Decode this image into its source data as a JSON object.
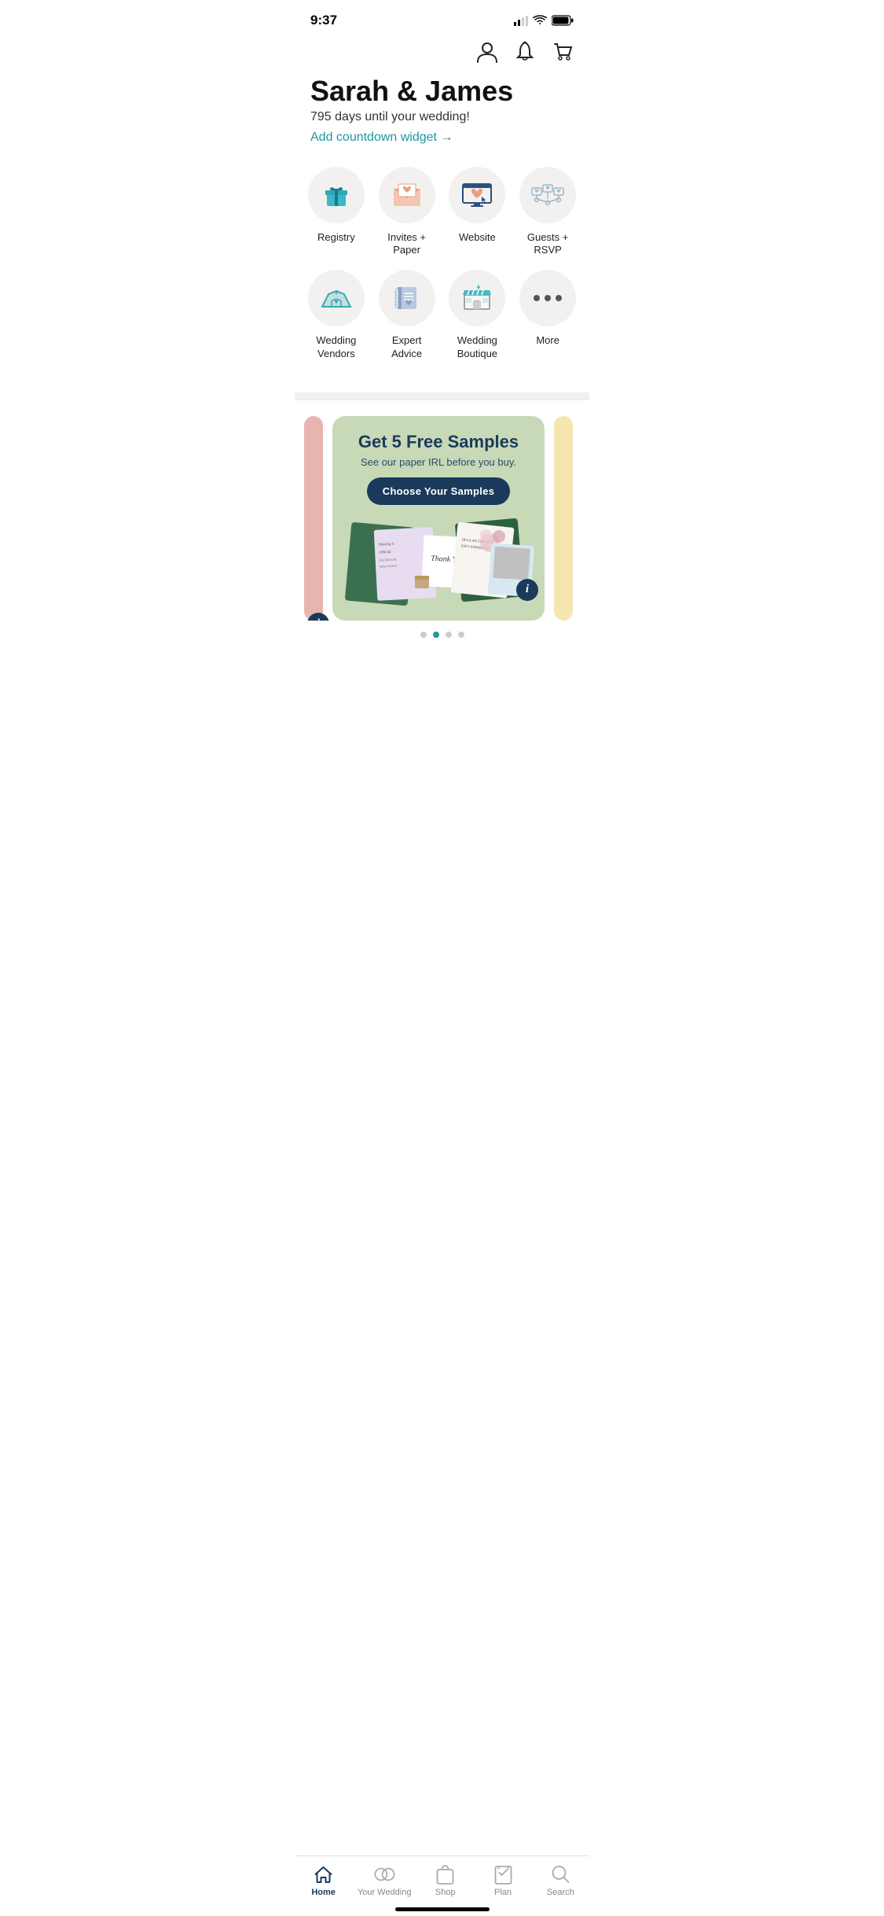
{
  "statusBar": {
    "time": "9:37"
  },
  "header": {
    "coupleName": "Sarah & James",
    "countdownText": "795 days until your wedding!",
    "countdownLink": "Add countdown widget →"
  },
  "navItems": [
    {
      "id": "registry",
      "label": "Registry",
      "icon": "gift"
    },
    {
      "id": "invites",
      "label": "Invites +\nPaper",
      "icon": "envelope"
    },
    {
      "id": "website",
      "label": "Website",
      "icon": "monitor"
    },
    {
      "id": "guests",
      "label": "Guests +\nRSVP",
      "icon": "guests"
    },
    {
      "id": "vendors",
      "label": "Wedding\nVendors",
      "icon": "tent"
    },
    {
      "id": "advice",
      "label": "Expert\nAdvice",
      "icon": "book"
    },
    {
      "id": "boutique",
      "label": "Wedding\nBoutique",
      "icon": "store"
    },
    {
      "id": "more",
      "label": "More",
      "icon": "dots"
    }
  ],
  "carousel": {
    "cards": [
      {
        "id": "samples",
        "title": "Get 5 Free Samples",
        "subtitle": "See our paper IRL before you buy.",
        "buttonLabel": "Choose Your Samples",
        "bgColor": "#c8d9b8"
      }
    ],
    "activeDot": 1,
    "totalDots": 4
  },
  "bottomNav": {
    "items": [
      {
        "id": "home",
        "label": "Home",
        "active": true
      },
      {
        "id": "wedding",
        "label": "Your Wedding",
        "active": false
      },
      {
        "id": "shop",
        "label": "Shop",
        "active": false
      },
      {
        "id": "plan",
        "label": "Plan",
        "active": false
      },
      {
        "id": "search",
        "label": "Search",
        "active": false
      }
    ]
  }
}
